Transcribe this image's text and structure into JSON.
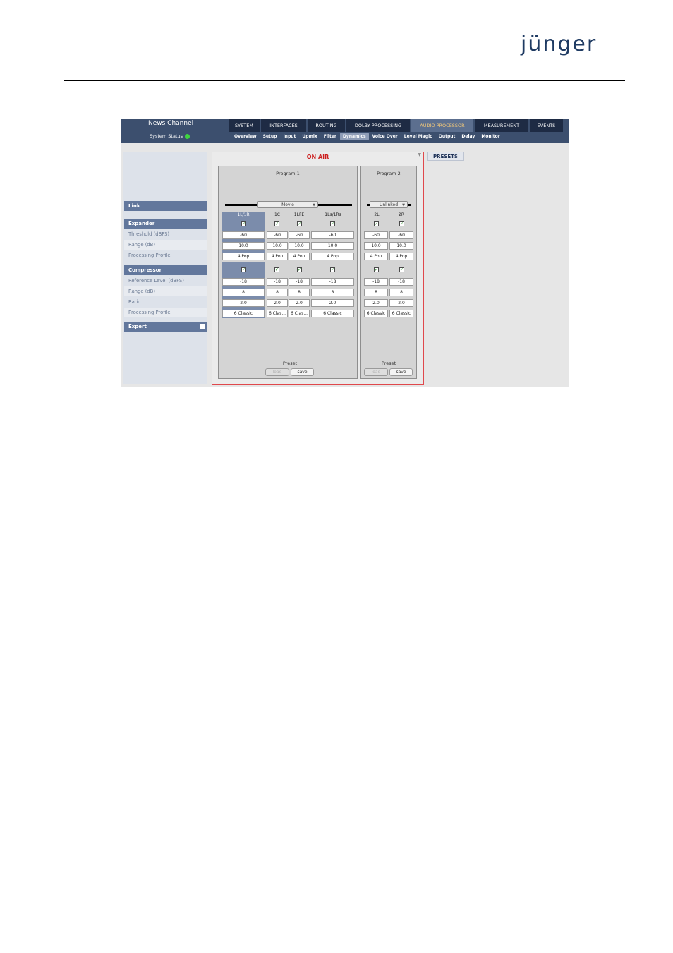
{
  "document": {
    "brand": "jünger"
  },
  "app": {
    "title": "News Channel",
    "system_status_label": "System Status",
    "status_color": "#3fd43f",
    "tabs": [
      {
        "label": "SYSTEM",
        "active": false
      },
      {
        "label": "INTERFACES",
        "active": false
      },
      {
        "label": "ROUTING",
        "active": false
      },
      {
        "label": "DOLBY PROCESSING",
        "active": false
      },
      {
        "label": "AUDIO PROCESSOR",
        "active": true
      },
      {
        "label": "MEASUREMENT",
        "active": false
      },
      {
        "label": "EVENTS",
        "active": false
      }
    ],
    "subtabs": [
      {
        "label": "Overview",
        "active": false
      },
      {
        "label": "Setup",
        "active": false
      },
      {
        "label": "Input",
        "active": false
      },
      {
        "label": "Upmix",
        "active": false
      },
      {
        "label": "Filter",
        "active": false
      },
      {
        "label": "Dynamics",
        "active": true
      },
      {
        "label": "Voice Over",
        "active": false
      },
      {
        "label": "Level Magic",
        "active": false
      },
      {
        "label": "Output",
        "active": false
      },
      {
        "label": "Delay",
        "active": false
      },
      {
        "label": "Monitor",
        "active": false
      }
    ]
  },
  "sidebar": {
    "link": "Link",
    "expander": {
      "header": "Expander",
      "rows": [
        "Threshold (dBFS)",
        "Range (dB)",
        "Processing Profile"
      ]
    },
    "compressor": {
      "header": "Compressor",
      "rows": [
        "Reference Level (dBFS)",
        "Range (dB)",
        "Ratio",
        "Processing Profile"
      ]
    },
    "expert": "Expert"
  },
  "main": {
    "status": "ON AIR",
    "status_color": "#cc1d1d",
    "presets_button": "PRESETS",
    "programs": [
      {
        "title": "Program 1",
        "link_mode": "Movie",
        "channels": [
          {
            "label": "1L/1R",
            "selected": true,
            "expander": {
              "enabled": true,
              "threshold": "-60",
              "range": "10.0",
              "profile": "4 Pop"
            },
            "compressor": {
              "enabled": true,
              "reference": "-18",
              "range": "8",
              "ratio": "2.0",
              "profile": "6 Classic"
            }
          },
          {
            "label": "1C",
            "selected": false,
            "expander": {
              "enabled": true,
              "threshold": "-60",
              "range": "10.0",
              "profile": "4 Pop"
            },
            "compressor": {
              "enabled": true,
              "reference": "-18",
              "range": "8",
              "ratio": "2.0",
              "profile": "6 Clas..."
            }
          },
          {
            "label": "1LFE",
            "selected": false,
            "expander": {
              "enabled": true,
              "threshold": "-60",
              "range": "10.0",
              "profile": "4 Pop"
            },
            "compressor": {
              "enabled": true,
              "reference": "-18",
              "range": "8",
              "ratio": "2.0",
              "profile": "6 Clas..."
            }
          },
          {
            "label": "1Ls/1Rs",
            "selected": false,
            "expander": {
              "enabled": true,
              "threshold": "-60",
              "range": "10.0",
              "profile": "4 Pop"
            },
            "compressor": {
              "enabled": true,
              "reference": "-18",
              "range": "8",
              "ratio": "2.0",
              "profile": "6 Classic"
            }
          }
        ],
        "preset_label": "Preset",
        "load_label": "load",
        "save_label": "save"
      },
      {
        "title": "Program 2",
        "link_mode": "Unlinked",
        "channels": [
          {
            "label": "2L",
            "selected": false,
            "expander": {
              "enabled": true,
              "threshold": "-60",
              "range": "10.0",
              "profile": "4 Pop"
            },
            "compressor": {
              "enabled": true,
              "reference": "-18",
              "range": "8",
              "ratio": "2.0",
              "profile": "6 Classic"
            }
          },
          {
            "label": "2R",
            "selected": false,
            "expander": {
              "enabled": true,
              "threshold": "-60",
              "range": "10.0",
              "profile": "4 Pop"
            },
            "compressor": {
              "enabled": true,
              "reference": "-18",
              "range": "8",
              "ratio": "2.0",
              "profile": "6 Classic"
            }
          }
        ],
        "preset_label": "Preset",
        "load_label": "load",
        "save_label": "save"
      }
    ]
  }
}
